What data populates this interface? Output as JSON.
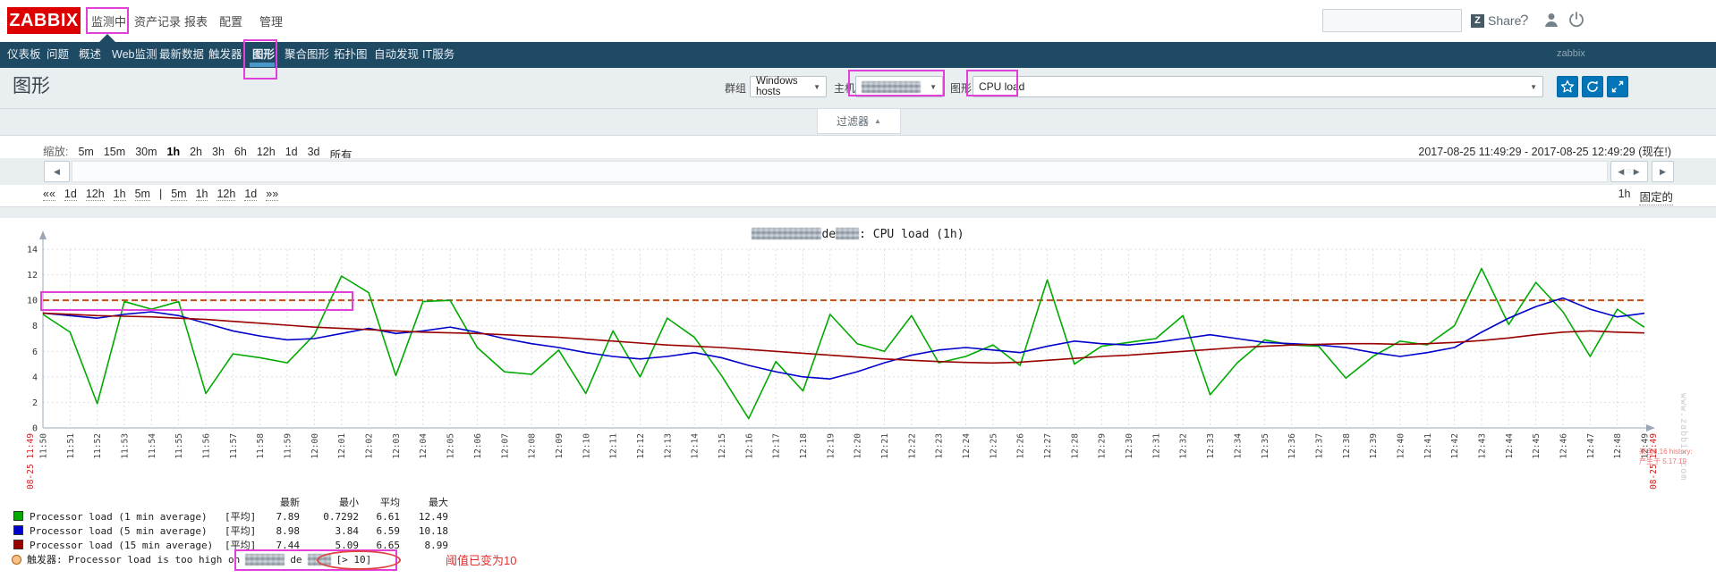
{
  "brand": {
    "logo": "ZABBIX"
  },
  "top_nav": {
    "items": [
      "监测中",
      "资产记录",
      "报表",
      "配置",
      "管理"
    ],
    "active_index": 0,
    "share_logo": "Z",
    "share_label": "Share",
    "help_label": "?"
  },
  "sub_nav": {
    "items": [
      "仪表板",
      "问题",
      "概述",
      "Web监测",
      "最新数据",
      "触发器",
      "图形",
      "聚合图形",
      "拓扑图",
      "自动发现",
      "IT服务"
    ],
    "active_index": 6,
    "right_text": "zabbix"
  },
  "page": {
    "title": "图形"
  },
  "filter_bar": {
    "group_label": "群组",
    "group_value": "Windows hosts",
    "host_label": "主机",
    "host_redacted": true,
    "graph_label": "图形",
    "graph_value": "CPU load"
  },
  "filter_tab": {
    "label": "过滤器",
    "arrow": "▲"
  },
  "timebar": {
    "zoom_label": "缩放:",
    "zoom_links": [
      "5m",
      "15m",
      "30m",
      "1h",
      "2h",
      "3h",
      "6h",
      "12h",
      "1d",
      "3d",
      "所有"
    ],
    "zoom_active": "1h",
    "date_start": "2017-08-25 11:49:29",
    "date_sep": " - ",
    "date_end": "2017-08-25 12:49:29 (现在!)",
    "nav_links_left": [
      "««",
      "1d",
      "12h",
      "1h",
      "5m",
      "|",
      "5m",
      "1h",
      "12h",
      "1d",
      "»»"
    ],
    "period_label": "1h",
    "fixed_label": "固定的"
  },
  "chart": {
    "title_host_fragment": "de",
    "title_suffix": ": CPU load (1h)",
    "left_date_label": "08-25 11:49",
    "right_date_label": "08-25 12:49"
  },
  "chart_data": {
    "type": "line",
    "title": "CPU load (1h)",
    "x": [
      "11:50",
      "11:51",
      "11:52",
      "11:53",
      "11:54",
      "11:55",
      "11:56",
      "11:57",
      "11:58",
      "11:59",
      "12:00",
      "12:01",
      "12:02",
      "12:03",
      "12:04",
      "12:05",
      "12:06",
      "12:07",
      "12:08",
      "12:09",
      "12:10",
      "12:11",
      "12:12",
      "12:13",
      "12:14",
      "12:15",
      "12:16",
      "12:17",
      "12:18",
      "12:19",
      "12:20",
      "12:21",
      "12:22",
      "12:23",
      "12:24",
      "12:25",
      "12:26",
      "12:27",
      "12:28",
      "12:29",
      "12:30",
      "12:31",
      "12:32",
      "12:33",
      "12:34",
      "12:35",
      "12:36",
      "12:37",
      "12:38",
      "12:39",
      "12:40",
      "12:41",
      "12:42",
      "12:43",
      "12:44",
      "12:45",
      "12:46",
      "12:47",
      "12:48",
      "12:49"
    ],
    "ylim": [
      0,
      14
    ],
    "yticks": [
      0,
      2,
      4,
      6,
      8,
      10,
      12,
      14
    ],
    "grid": true,
    "trigger_line_value": 10,
    "trigger_line_color": "#c05018",
    "series": [
      {
        "name": "Processor load (1 min average)",
        "color": "#00aa00",
        "values": [
          8.9,
          7.5,
          1.9,
          9.9,
          9.3,
          9.9,
          2.7,
          5.8,
          5.5,
          5.1,
          7.3,
          11.9,
          10.6,
          4.1,
          9.9,
          10.0,
          6.3,
          4.4,
          4.2,
          6.1,
          2.7,
          7.6,
          4.0,
          8.6,
          7.1,
          4.1,
          0.73,
          5.2,
          2.9,
          8.9,
          6.6,
          6.0,
          8.8,
          5.1,
          5.6,
          6.5,
          4.9,
          11.6,
          5.0,
          6.4,
          6.7,
          7.0,
          8.8,
          2.6,
          5.1,
          6.9,
          6.5,
          6.4,
          3.9,
          5.6,
          6.8,
          6.5,
          8.0,
          12.49,
          8.1,
          11.4,
          9.1,
          5.6,
          9.3,
          7.89
        ]
      },
      {
        "name": "Processor load (5 min average)",
        "color": "#0000cc",
        "values": [
          9.0,
          8.8,
          8.6,
          8.9,
          9.1,
          8.8,
          8.2,
          7.6,
          7.2,
          6.9,
          7.0,
          7.4,
          7.8,
          7.4,
          7.6,
          7.9,
          7.5,
          7.0,
          6.6,
          6.3,
          5.9,
          5.6,
          5.4,
          5.6,
          5.9,
          5.5,
          4.9,
          4.4,
          4.0,
          3.84,
          4.4,
          5.1,
          5.7,
          6.1,
          6.3,
          6.1,
          5.9,
          6.4,
          6.8,
          6.6,
          6.5,
          6.7,
          7.0,
          7.3,
          7.0,
          6.7,
          6.6,
          6.5,
          6.3,
          5.9,
          5.6,
          5.9,
          6.3,
          7.5,
          8.6,
          9.5,
          10.18,
          9.3,
          8.7,
          8.98
        ]
      },
      {
        "name": "Processor load (15 min average)",
        "color": "#990000",
        "values": [
          8.99,
          8.9,
          8.8,
          8.75,
          8.7,
          8.6,
          8.5,
          8.35,
          8.2,
          8.05,
          7.9,
          7.8,
          7.7,
          7.6,
          7.5,
          7.45,
          7.4,
          7.3,
          7.2,
          7.1,
          6.95,
          6.8,
          6.65,
          6.5,
          6.4,
          6.3,
          6.15,
          6.0,
          5.85,
          5.7,
          5.55,
          5.4,
          5.3,
          5.2,
          5.13,
          5.09,
          5.15,
          5.3,
          5.45,
          5.6,
          5.7,
          5.85,
          6.0,
          6.15,
          6.3,
          6.4,
          6.5,
          6.55,
          6.6,
          6.6,
          6.55,
          6.6,
          6.7,
          6.85,
          7.05,
          7.3,
          7.5,
          7.6,
          7.5,
          7.44
        ]
      }
    ],
    "x_end_labels": {
      "left": "08-25 11:49",
      "right": "08-25 12:49"
    },
    "legend_position": "bottom"
  },
  "legend": {
    "headers": [
      "最新",
      "最小",
      "平均",
      "最大"
    ],
    "rows": [
      {
        "color": "#00aa00",
        "label": "Processor load (1 min average)",
        "func": "[平均]",
        "last": "7.89",
        "min": "0.7292",
        "avg": "6.61",
        "max": "12.49"
      },
      {
        "color": "#0000cc",
        "label": "Processor load (5 min average)",
        "func": "[平均]",
        "last": "8.98",
        "min": "3.84",
        "avg": "6.59",
        "max": "10.18"
      },
      {
        "color": "#990000",
        "label": "Processor load (15 min average)",
        "func": "[平均]",
        "last": "7.44",
        "min": "5.09",
        "avg": "6.65",
        "max": "8.99"
      }
    ],
    "trigger": {
      "prefix": "触发器: Processor load is too high on",
      "host_fragment": "de",
      "expression": "[> 10]"
    }
  },
  "annotations": {
    "threshold_note": "阈值已变为10"
  },
  "watermarks": {
    "zabbix": "www.zabbix.com",
    "red_line1": "来自8.16 history:",
    "red_line2": "产生于 5.17.19"
  },
  "colors": {
    "accent_blue": "#0275b8",
    "logo_red": "#dd0000",
    "nav_dark": "#1f4a64",
    "annotation_magenta": "#e03fd8",
    "annotation_red": "#e03030"
  }
}
